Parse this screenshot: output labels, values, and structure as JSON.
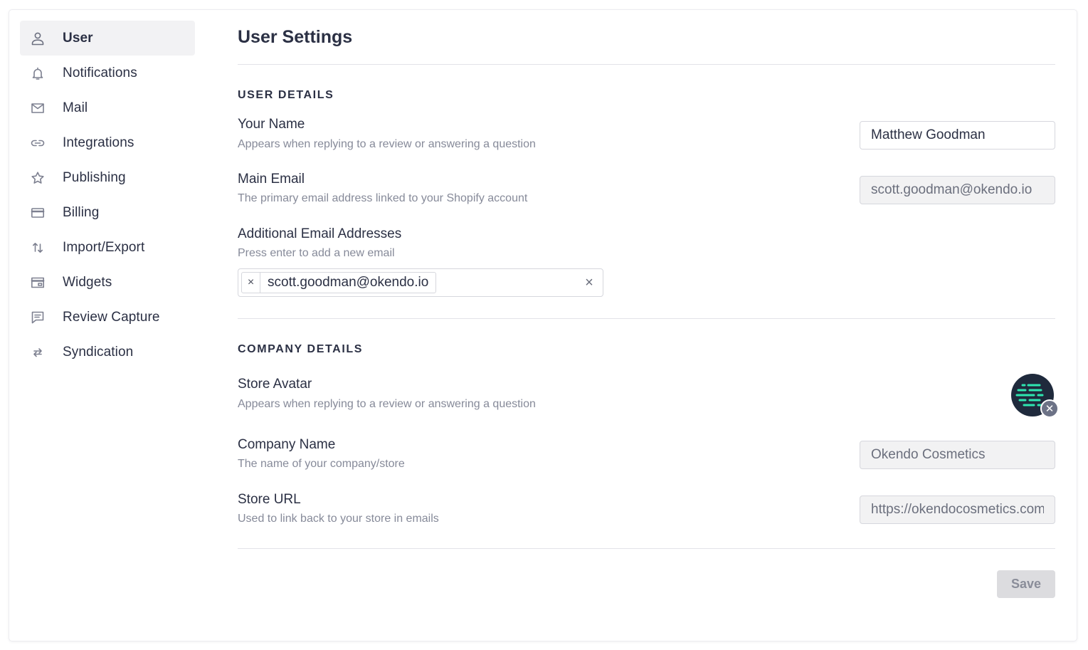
{
  "sidebar": {
    "items": [
      {
        "label": "User",
        "icon": "user-icon",
        "active": true
      },
      {
        "label": "Notifications",
        "icon": "bell-icon"
      },
      {
        "label": "Mail",
        "icon": "mail-icon"
      },
      {
        "label": "Integrations",
        "icon": "link-icon"
      },
      {
        "label": "Publishing",
        "icon": "star-icon"
      },
      {
        "label": "Billing",
        "icon": "credit-card-icon"
      },
      {
        "label": "Import/Export",
        "icon": "arrows-vertical-icon"
      },
      {
        "label": "Widgets",
        "icon": "browser-window-icon"
      },
      {
        "label": "Review Capture",
        "icon": "chat-icon"
      },
      {
        "label": "Syndication",
        "icon": "swap-arrows-icon"
      }
    ]
  },
  "main": {
    "title": "User Settings",
    "user_details": {
      "heading": "USER DETAILS",
      "your_name": {
        "label": "Your Name",
        "help": "Appears when replying to a review or answering a question",
        "value": "Matthew Goodman"
      },
      "main_email": {
        "label": "Main Email",
        "help": "The primary email address linked to your Shopify account",
        "value": "scott.goodman@okendo.io"
      },
      "additional_emails": {
        "label": "Additional Email Addresses",
        "help": "Press enter to add a new email",
        "tags": [
          "scott.goodman@okendo.io"
        ],
        "remove_glyph": "×",
        "clear_glyph": "×"
      }
    },
    "company_details": {
      "heading": "COMPANY DETAILS",
      "store_avatar": {
        "label": "Store Avatar",
        "help": "Appears when replying to a review or answering a question",
        "remove_glyph": "✕"
      },
      "company_name": {
        "label": "Company Name",
        "help": "The name of your company/store",
        "value": "Okendo Cosmetics"
      },
      "store_url": {
        "label": "Store URL",
        "help": "Used to link back to your store in emails",
        "value": "https://okendocosmetics.com"
      }
    },
    "save_label": "Save"
  },
  "colors": {
    "text": "#2b3044",
    "muted_text": "#868a99",
    "active_nav_bg": "#f2f2f4",
    "avatar_bg": "#1f2a3c",
    "avatar_accent": "#2ee6b0",
    "save_bg": "#dcdcdf"
  }
}
